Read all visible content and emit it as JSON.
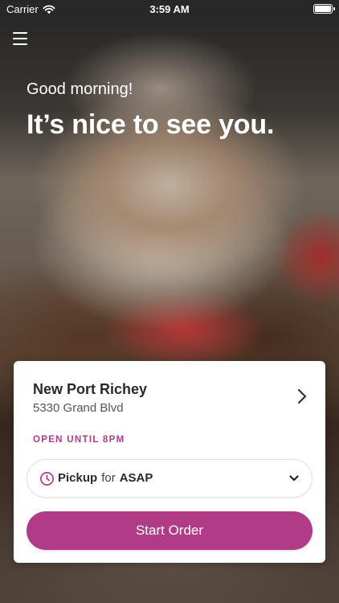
{
  "status_bar": {
    "carrier": "Carrier",
    "time": "3:59 AM"
  },
  "hero": {
    "greeting": "Good morning!",
    "headline": "It’s nice to see you."
  },
  "store": {
    "name": "New Port Richey",
    "address": "5330 Grand Blvd",
    "open_status": "OPEN UNTIL 8PM"
  },
  "order": {
    "mode": "Pickup",
    "connector": "for",
    "time": "ASAP"
  },
  "actions": {
    "start_order": "Start Order"
  },
  "icons": {
    "menu": "hamburger-menu-icon",
    "wifi": "wifi-icon",
    "battery": "battery-icon",
    "store_chevron": "chevron-right-icon",
    "clock": "clock-icon",
    "select_chevron": "chevron-down-icon"
  },
  "colors": {
    "accent": "#b13b86",
    "card_bg": "#ffffff",
    "text_dark": "#2a2a2a"
  }
}
